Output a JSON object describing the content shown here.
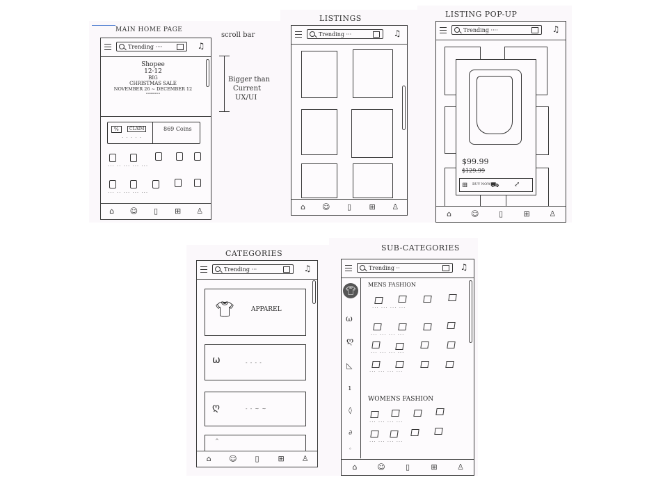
{
  "screens": {
    "main": {
      "title": "MAIN HOME PAGE",
      "search_placeholder": "Trending ····",
      "annotation_scroll": "scroll bar",
      "annotation_banner": [
        "Bigger than",
        "Current",
        "UX/UI"
      ],
      "banner": {
        "line1": "Shopee",
        "line2": "12·12",
        "line3": "BIG",
        "line4": "CHRISTMAS SALE",
        "line5": "NOVEMBER 26 ~ DECEMBER 12",
        "line6": "•••••••"
      },
      "voucher": {
        "pct": "%",
        "claim": "CLAIM",
        "coins": "869 Coins"
      }
    },
    "listings": {
      "title": "LISTINGS",
      "search_placeholder": "Trending ···"
    },
    "popup": {
      "title": "LISTING POP-UP",
      "search_placeholder": "Trending ····",
      "price": "$99.99",
      "old_price": "$129.99",
      "buy_now": "BUY NOW"
    },
    "categories": {
      "title": "CATEGORIES",
      "search_placeholder": "Trending ···",
      "apparel": "APPAREL"
    },
    "subcategories": {
      "title": "SUB-CATEGORIES",
      "search_placeholder": "Trending ··",
      "mens": "MENS FASHION",
      "womens": "WOMENS FASHION"
    }
  },
  "icons": {
    "bell": "bell-icon",
    "home": "home-icon",
    "smile": "smile-icon",
    "bag": "bag-icon",
    "cart": "cart-icon",
    "user": "user-icon"
  }
}
